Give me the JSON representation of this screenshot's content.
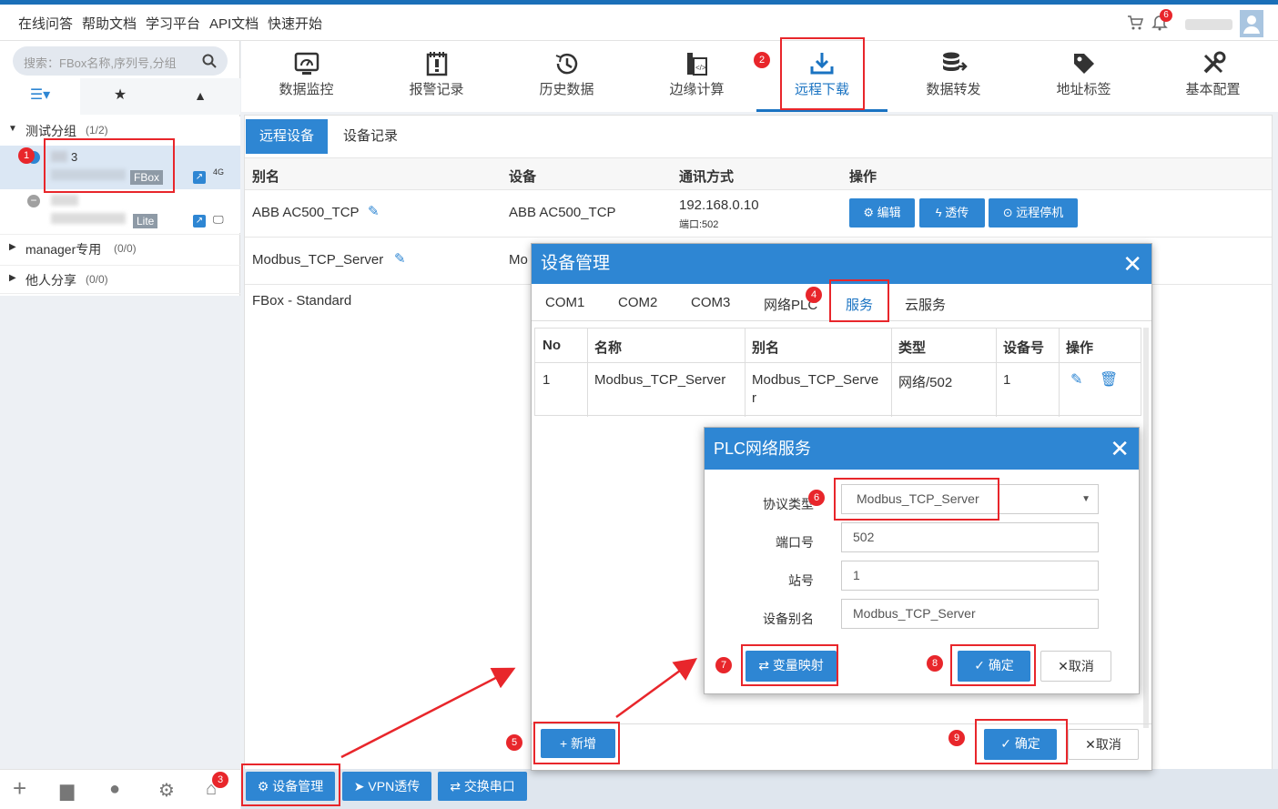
{
  "topnav": {
    "links": [
      "在线问答",
      "帮助文档",
      "学习平台",
      "API文档",
      "快速开始"
    ],
    "notification_count": "6"
  },
  "sidebar": {
    "search_placeholder": "搜索：FBox名称,序列号,分组",
    "groups": [
      {
        "name": "测试分组",
        "count": "(1/2)"
      },
      {
        "name": "manager专用",
        "count": "(0/0)"
      },
      {
        "name": "他人分享",
        "count": "(0/0)"
      }
    ],
    "devices": [
      {
        "name_suffix": "3",
        "type": "FBox",
        "signal": "4G"
      },
      {
        "type": "Lite"
      }
    ]
  },
  "toolbar": {
    "items": [
      "数据监控",
      "报警记录",
      "历史数据",
      "边缘计算",
      "远程下载",
      "数据转发",
      "地址标签",
      "基本配置"
    ],
    "active": "远程下载"
  },
  "panel": {
    "tabs": [
      "远程设备",
      "设备记录"
    ],
    "headers": [
      "别名",
      "设备",
      "通讯方式",
      "操作"
    ],
    "rows": [
      {
        "alias": "ABB AC500_TCP",
        "device": "ABB AC500_TCP",
        "comm": "192.168.0.10",
        "port": "端口:502"
      },
      {
        "alias": "Modbus_TCP_Server",
        "device": "Mo"
      },
      {
        "alias": "FBox - Standard"
      }
    ],
    "row_buttons": [
      "编辑",
      "透传",
      "远程停机"
    ]
  },
  "bottom_buttons": [
    "设备管理",
    "VPN透传",
    "交换串口"
  ],
  "dialog_device": {
    "title": "设备管理",
    "tabs": [
      "COM1",
      "COM2",
      "COM3",
      "网络PLC",
      "服务",
      "云服务"
    ],
    "active_tab": "服务",
    "headers": [
      "No",
      "名称",
      "别名",
      "类型",
      "设备号",
      "操作"
    ],
    "row": {
      "no": "1",
      "name": "Modbus_TCP_Server",
      "alias": "Modbus_TCP_Serve",
      "alias_wrap": "r",
      "type": "网络/502",
      "devno": "1"
    },
    "add_button": "新增",
    "ok": "确定",
    "cancel": "取消"
  },
  "dialog_plc": {
    "title": "PLC网络服务",
    "fields": {
      "protocol_label": "协议类型",
      "protocol_value": "Modbus_TCP_Server",
      "port_label": "端口号",
      "port_value": "502",
      "station_label": "站号",
      "station_value": "1",
      "alias_label": "设备别名",
      "alias_value": "Modbus_TCP_Server"
    },
    "map_button": "变量映射",
    "ok": "确定",
    "cancel": "取消"
  },
  "step_badges": [
    "1",
    "2",
    "3",
    "4",
    "5",
    "6",
    "7",
    "8",
    "9"
  ],
  "colors": {
    "accent": "#2e86d3",
    "highlight": "#e8262b"
  }
}
